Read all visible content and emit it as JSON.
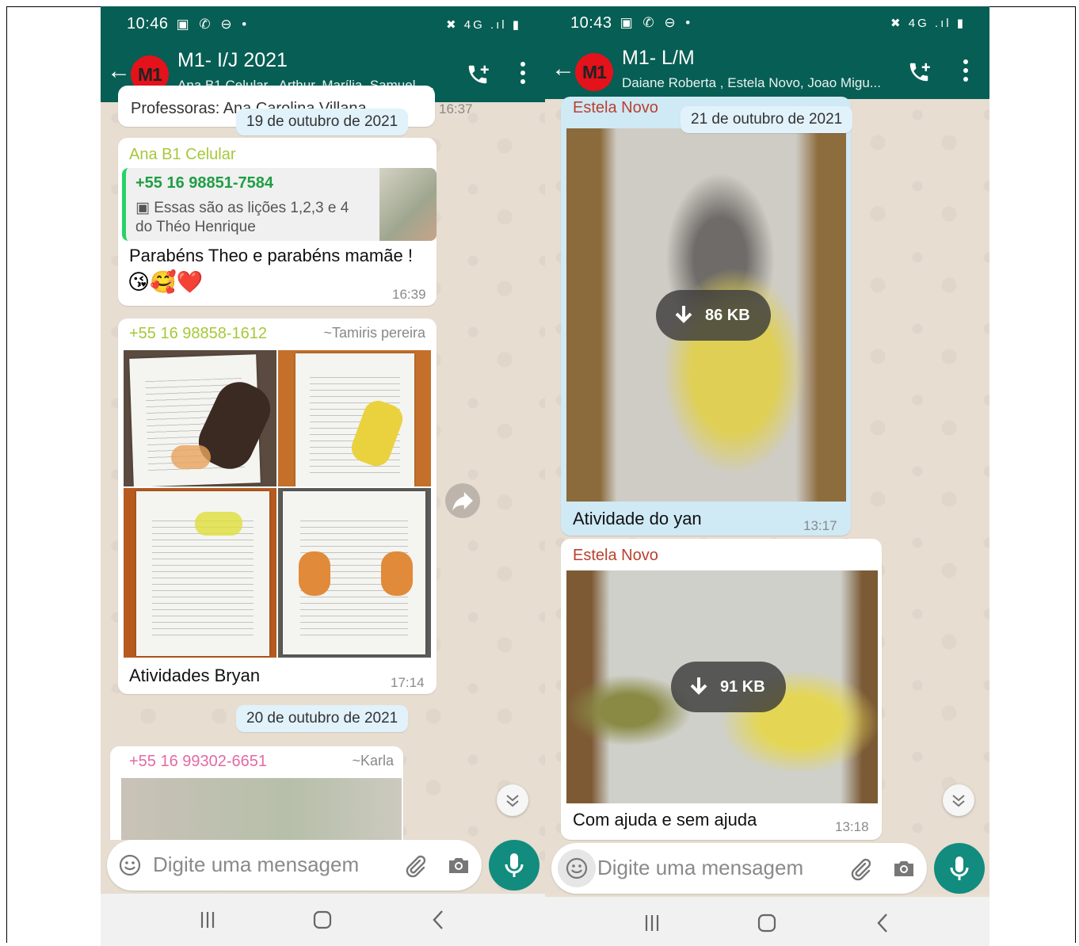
{
  "left": {
    "status": {
      "time": "10:46",
      "icons": "▣ ✆ ⊖ •",
      "right": "✖ 4G .ıl ▮"
    },
    "header": {
      "avatar": "M1",
      "title": "M1- I/J 2021",
      "subtitle": "Ana B1 Celular , Arthur, Marília, Samuel, ..."
    },
    "top_partial": {
      "text": "Professoras: Ana Carolina Villana",
      "time": "16:37"
    },
    "date1": "19 de outubro de 2021",
    "msg1": {
      "sender": "Ana B1 Celular",
      "quote_sender": "+55 16 98851-7584",
      "quote_line1": "Essas são as lições 1,2,3 e 4",
      "quote_line2": "do Théo Henrique",
      "text": "Parabéns Theo e parabéns mamãe !",
      "emojis": "😘🥰❤️",
      "time": "16:39"
    },
    "msg2": {
      "sender": "+55 16 98858-1612",
      "name": "~Tamiris pereira",
      "caption": "Atividades Bryan",
      "time": "17:14"
    },
    "date2": "20 de outubro de 2021",
    "msg3": {
      "sender": "+55 16 99302-6651",
      "name": "~Karla"
    },
    "input_placeholder": "Digite uma mensagem"
  },
  "right": {
    "status": {
      "time": "10:43",
      "icons": "▣ ✆ ⊖ •",
      "right": "✖ 4G .ıl ▮"
    },
    "header": {
      "avatar": "M1",
      "title": "M1- L/M",
      "subtitle": "Daiane Roberta , Estela Novo, Joao Migu..."
    },
    "date1": "21 de outubro de 2021",
    "msg1": {
      "sender": "Estela Novo",
      "size": "86 KB",
      "caption": "Atividade do yan",
      "time": "13:17"
    },
    "msg2": {
      "sender": "Estela Novo",
      "size": "91 KB",
      "caption": "Com ajuda e sem ajuda",
      "time": "13:18"
    },
    "input_placeholder": "Digite uma mensagem"
  },
  "colors": {
    "header": "#075e54",
    "accent": "#128c7e",
    "own_bubble": "#dcf8c6",
    "date_chip": "#e1f2fb"
  }
}
